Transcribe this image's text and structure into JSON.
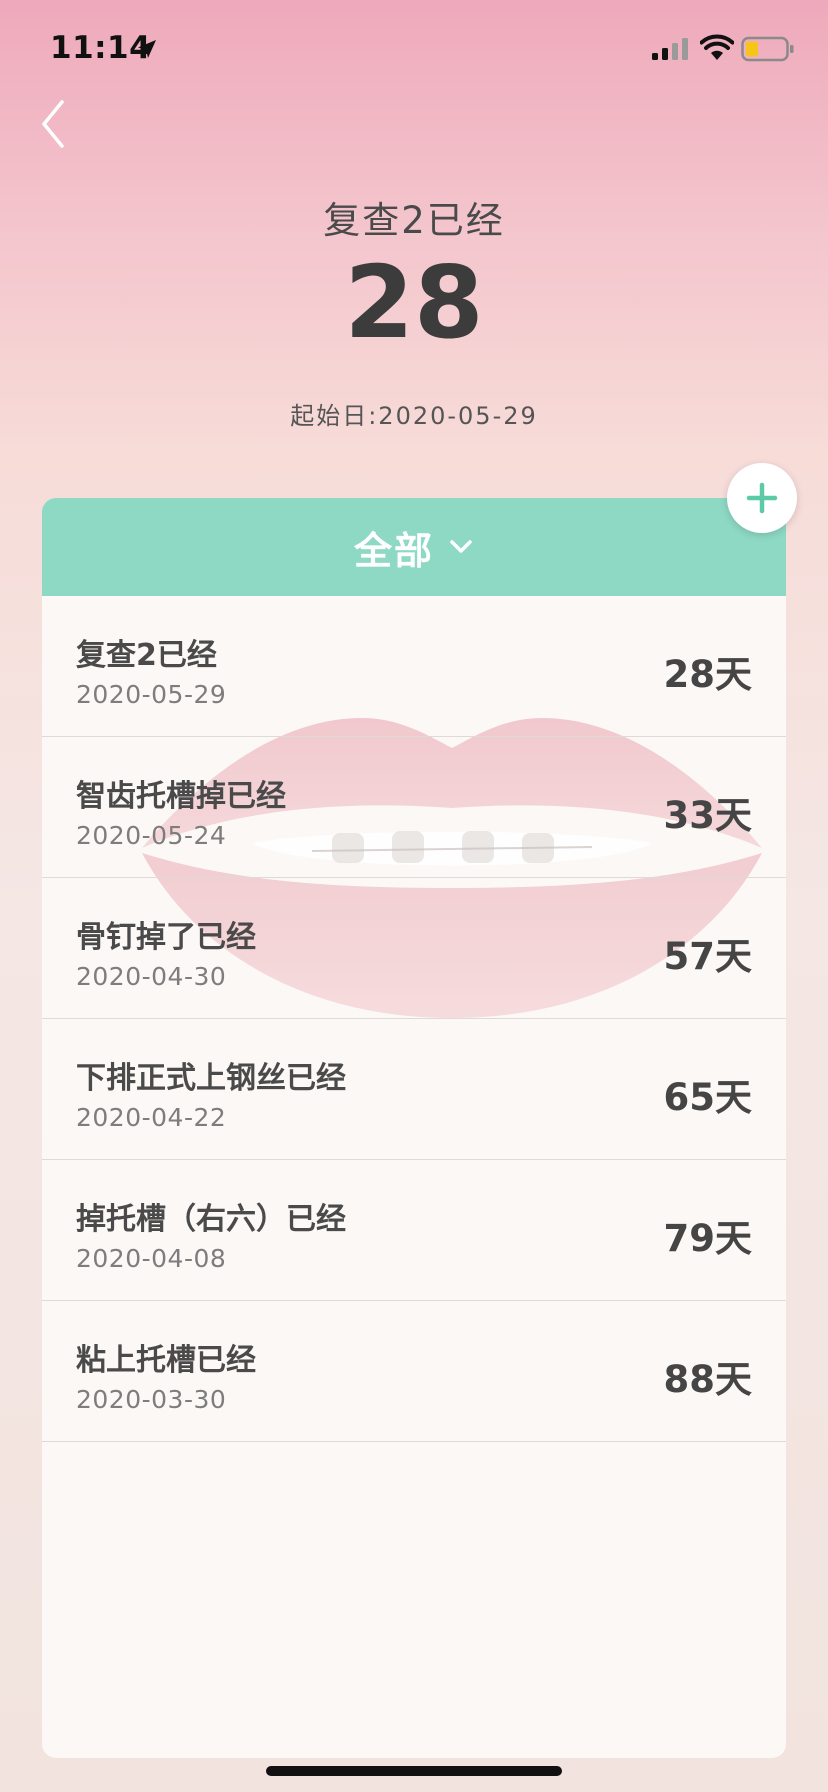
{
  "status_bar": {
    "time": "11:14",
    "icons": [
      "location-icon",
      "signal-icon",
      "wifi-icon",
      "battery-icon"
    ]
  },
  "nav": {
    "back_icon": "chevron-left-icon"
  },
  "header": {
    "subtitle": "复查2已经",
    "count": "28",
    "start_date": "起始日:2020-05-29"
  },
  "filter": {
    "label": "全部",
    "icon": "chevron-down-icon"
  },
  "add_button": {
    "icon": "plus-icon"
  },
  "events": [
    {
      "title": "复查2已经",
      "date": "2020-05-29",
      "days": "28天"
    },
    {
      "title": "智齿托槽掉已经",
      "date": "2020-05-24",
      "days": "33天"
    },
    {
      "title": "骨钉掉了已经",
      "date": "2020-04-30",
      "days": "57天"
    },
    {
      "title": "下排正式上钢丝已经",
      "date": "2020-04-22",
      "days": "65天"
    },
    {
      "title": "掉托槽（右六）已经",
      "date": "2020-04-08",
      "days": "79天"
    },
    {
      "title": "粘上托槽已经",
      "date": "2020-03-30",
      "days": "88天"
    }
  ],
  "colors": {
    "accent": "#8dd9c4",
    "plus": "#5cc9a7",
    "card_bg": "#fcf8f6",
    "gradient_top": "#eea9bb"
  }
}
